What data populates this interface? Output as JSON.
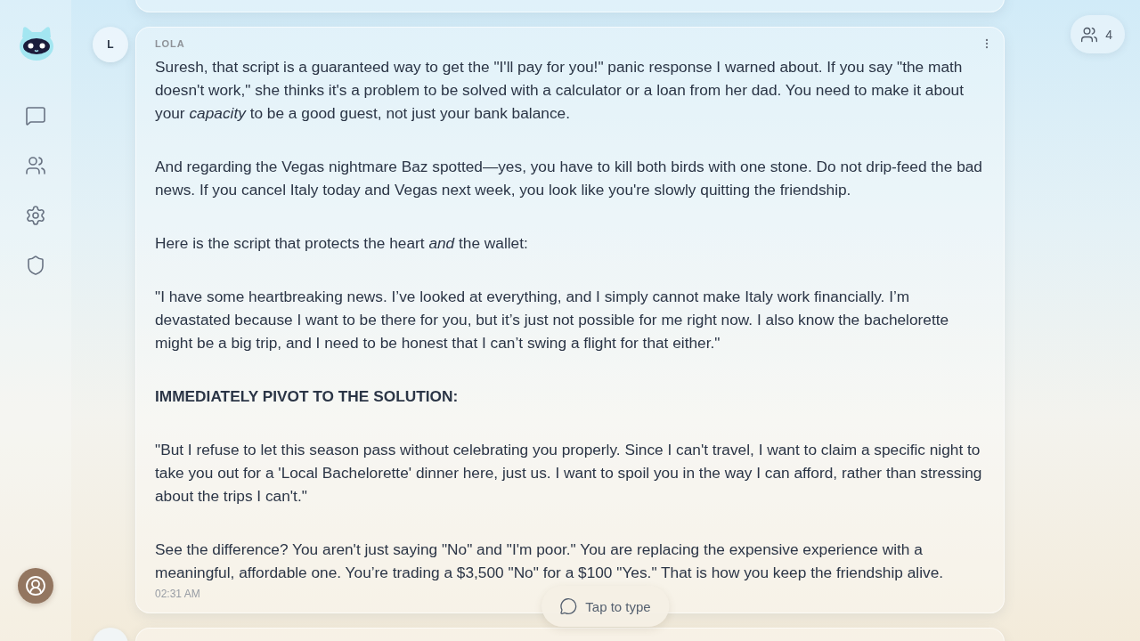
{
  "members_button": {
    "count": "4"
  },
  "message": {
    "author_initial": "L",
    "author": "LOLA",
    "paragraphs": [
      {
        "kind": "text",
        "text": "Suresh, that script is a guaranteed way to get the \"I'll pay for you!\" panic response I warned about. If you say \"the math doesn't work,\" she thinks it's a problem to be solved with a calculator or a loan from her dad. You need to make it about your *capacity* to be a good guest, not just your bank balance."
      },
      {
        "kind": "text",
        "text": "And regarding the Vegas nightmare Baz spotted—yes, you have to kill both birds with one stone. Do not drip-feed the bad news. If you cancel Italy today and Vegas next week, you look like you're slowly quitting the friendship."
      },
      {
        "kind": "text",
        "text": "Here is the script that protects the heart *and* the wallet:"
      },
      {
        "kind": "text",
        "text": "\"I have some heartbreaking news. I’ve looked at everything, and I simply cannot make Italy work financially. I’m devastated because I want to be there for you, but it’s just not possible for me right now. I also know the bachelorette might be a big trip, and I need to be honest that I can’t swing a flight for that either.\""
      },
      {
        "kind": "heading",
        "text": "IMMEDIATELY PIVOT TO THE SOLUTION:"
      },
      {
        "kind": "text",
        "text": "\"But I refuse to let this season pass without celebrating you properly. Since I can't travel, I want to claim a specific night to take you out for a 'Local Bachelorette' dinner here, just us. I want to spoil you in the way I can afford, rather than stressing about the trips I can't.\""
      },
      {
        "kind": "text",
        "text": "See the difference? You aren't just saying \"No\" and \"I'm poor.\" You are replacing the expensive experience with a meaningful, affordable one. You’re trading a $3,500 \"No\" for a $100 \"Yes.\" That is how you keep the friendship alive."
      }
    ],
    "time": "02:31 AM"
  },
  "compose_button": {
    "label": "Tap to type"
  }
}
